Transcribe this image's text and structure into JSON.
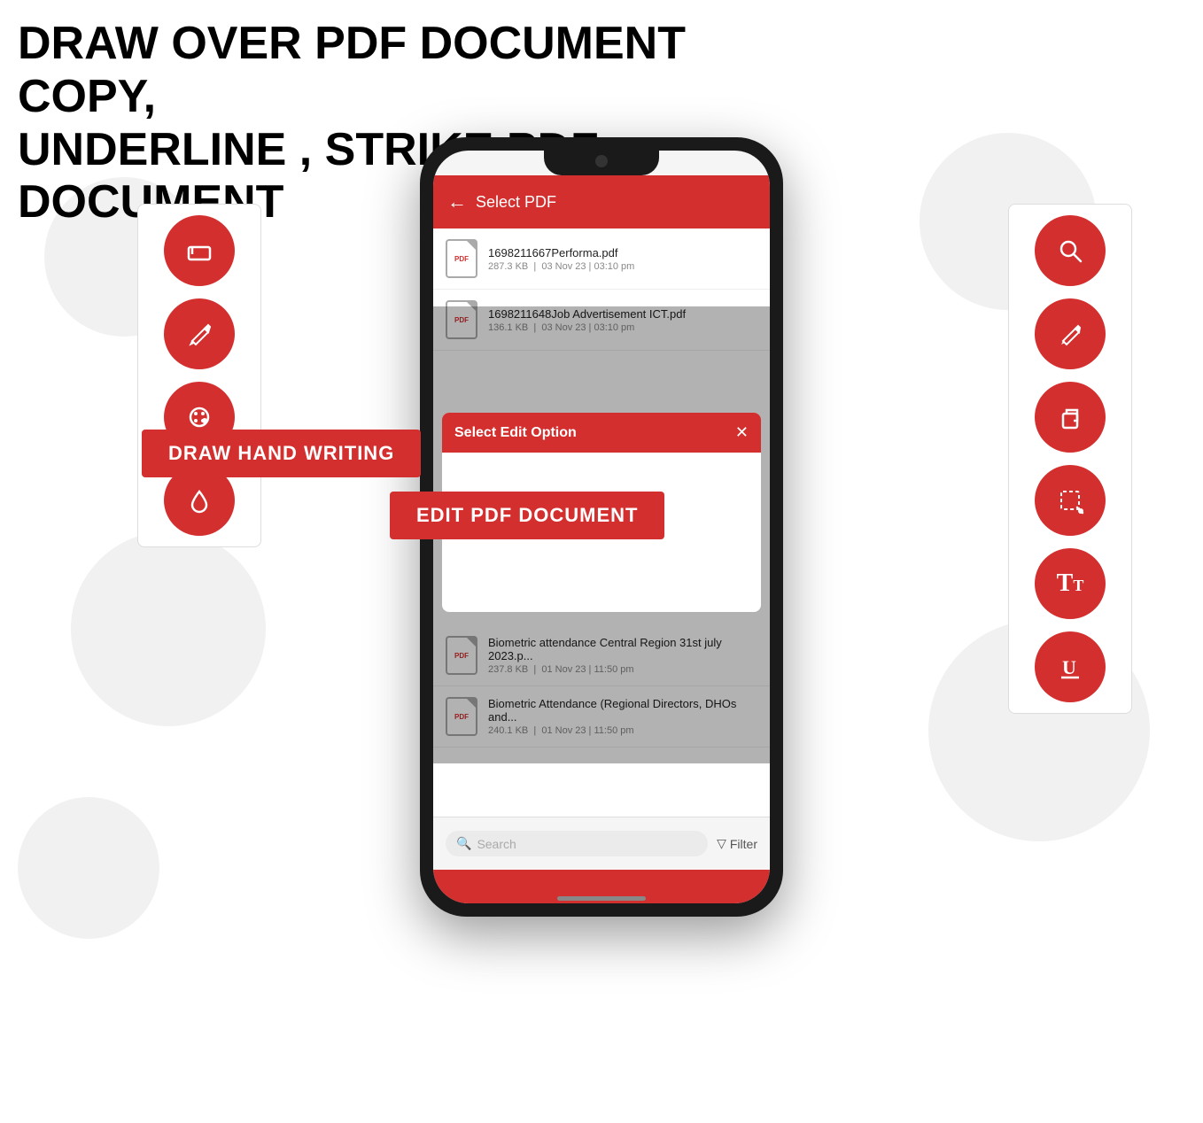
{
  "page": {
    "title_line1": "DRAW OVER PDF DOCUMENT COPY,",
    "title_line2": "UNDERLINE , STRIKE PDF DOCUMENT"
  },
  "left_toolbar": {
    "buttons": [
      {
        "icon": "eraser",
        "label": "Eraser tool",
        "unicode": "⌫"
      },
      {
        "icon": "pencil",
        "label": "Pencil tool",
        "unicode": "✏"
      },
      {
        "icon": "palette",
        "label": "Color picker",
        "unicode": "🎨"
      },
      {
        "icon": "drop",
        "label": "Fill tool",
        "unicode": "💧"
      }
    ]
  },
  "right_toolbar": {
    "buttons": [
      {
        "icon": "search",
        "label": "Search",
        "unicode": "🔍"
      },
      {
        "icon": "edit",
        "label": "Edit",
        "unicode": "✏"
      },
      {
        "icon": "copy",
        "label": "Copy",
        "unicode": "⧉"
      },
      {
        "icon": "select",
        "label": "Select region",
        "unicode": "⬚"
      },
      {
        "icon": "text",
        "label": "Text",
        "unicode": "Tt"
      },
      {
        "icon": "underline",
        "label": "Underline",
        "unicode": "U̲"
      }
    ]
  },
  "phone": {
    "app_bar": {
      "back_icon": "←",
      "title": "Select PDF"
    },
    "files": [
      {
        "name": "1698211667Performa.pdf",
        "size": "287.3 KB",
        "date": "03 Nov 23 | 03:10 pm"
      },
      {
        "name": "1698211648Job Advertisement ICT.pdf",
        "size": "136.1 KB",
        "date": "03 Nov 23 | 03:10 pm"
      },
      {
        "name": "Biometric attendance Central Region 31st july 2023.p...",
        "size": "237.8 KB",
        "date": "01 Nov 23 | 11:50 pm"
      },
      {
        "name": "Biometric Attendance (Regional Directors, DHOs and...",
        "size": "240.1 KB",
        "date": "01 Nov 23 | 11:50 pm"
      }
    ],
    "modal": {
      "title": "Select Edit Option",
      "close_icon": "✕"
    },
    "bottom_bar": {
      "search_placeholder": "Search",
      "filter_label": "Filter"
    }
  },
  "floating_buttons": {
    "btn1": "DRAW HAND WRITING",
    "btn2": "EDIT PDF DOCUMENT"
  }
}
